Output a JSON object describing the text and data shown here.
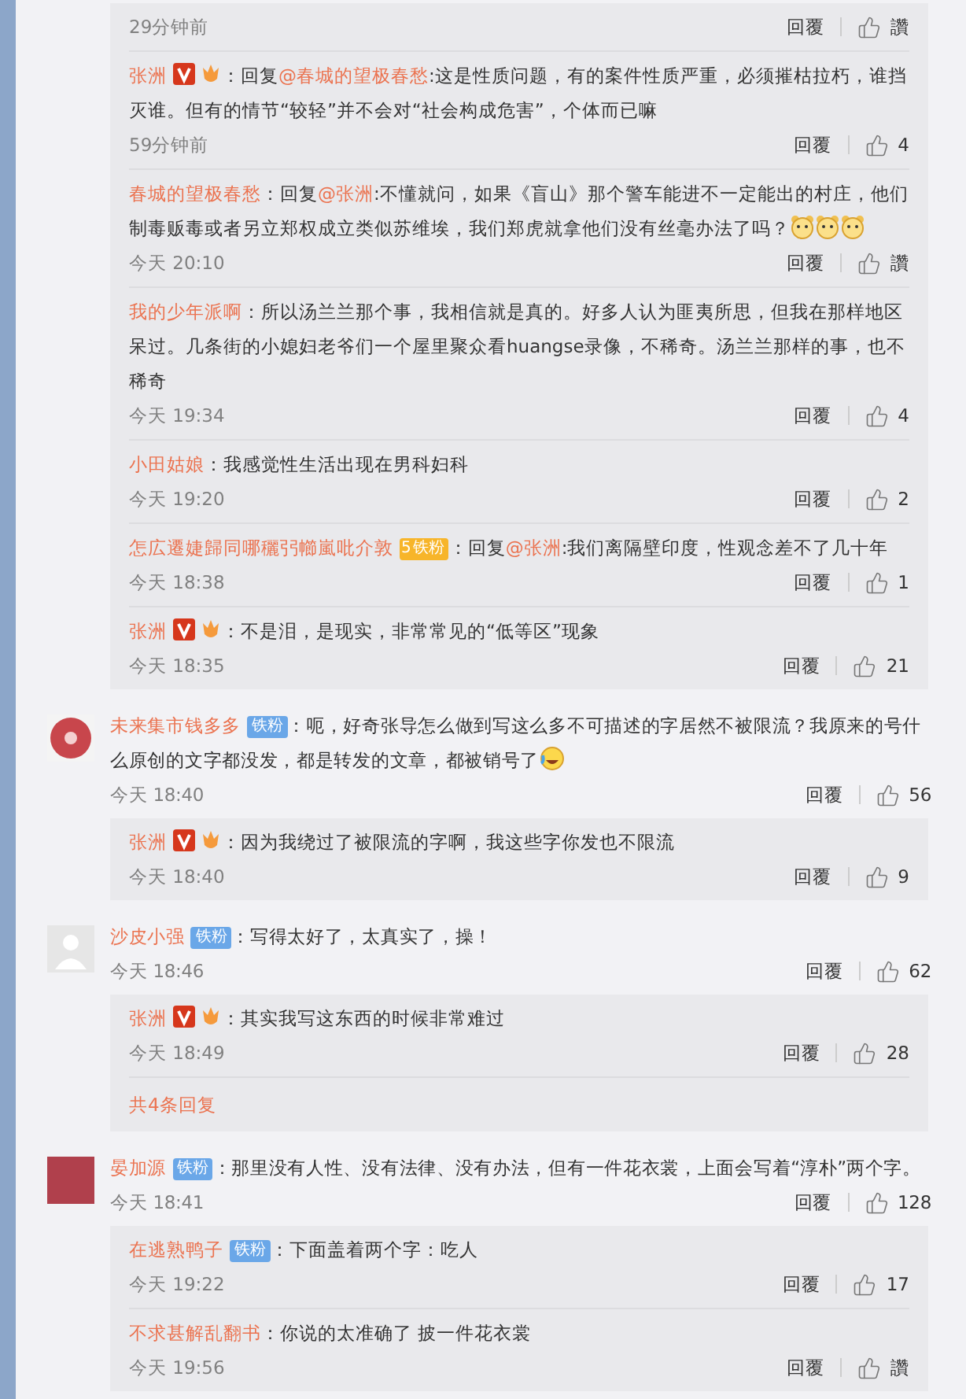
{
  "top_replies": [
    {
      "time": "29分钟前",
      "reply_label": "回覆",
      "likes": "讚"
    },
    {
      "user": "张洲",
      "badges": [
        {
          "kind": "verified"
        },
        {
          "kind": "medal"
        }
      ],
      "prefix": "：回复",
      "mention": "@春城的望极春愁",
      "text": ":这是性质问题，有的案件性质严重，必须摧枯拉朽，谁挡灭谁。但有的情节“较轻”并不会对“社会构成危害”，个体而已嘛",
      "time": "59分钟前",
      "reply_label": "回覆",
      "likes": "4"
    },
    {
      "user": "春城的望极春愁",
      "prefix": "：回复",
      "mention": "@张洲",
      "text": ":不懂就问，如果《盲山》那个警车能进不一定能出的村庄，他们制毒贩毒或者另立郑权成立类似苏维埃，我们郑虎就拿他们没有丝毫办法了吗？",
      "emojis": [
        {
          "kind": "bear"
        },
        {
          "kind": "bear"
        },
        {
          "kind": "bear"
        }
      ],
      "time": "今天 20:10",
      "reply_label": "回覆",
      "likes": "讚"
    },
    {
      "user": "我的少年派啊",
      "prefix": "：所以汤兰兰那个事，我相信就是真的。好多人认为匪夷所思，但我在那样地区呆过。几条街的小媳妇老爷们一个屋里聚众看huangse录像，不稀奇。汤兰兰那样的事，也不稀奇",
      "time": "今天 19:34",
      "reply_label": "回覆",
      "likes": "4"
    },
    {
      "user": "小田姑娘",
      "prefix": "：我感觉性生活出现在男科妇科",
      "time": "今天 19:20",
      "reply_label": "回覆",
      "likes": "2"
    },
    {
      "user": "怎広遷婕歸同哪穲弜幯嵐吡介敦",
      "badges": [
        {
          "kind": "gold_fan",
          "number": "5",
          "label": "铁粉"
        }
      ],
      "prefix": "：回复",
      "mention": "@张洲",
      "text": ":我们离隔壁印度，性观念差不了几十年",
      "time": "今天 18:38",
      "reply_label": "回覆",
      "likes": "1"
    },
    {
      "user": "张洲",
      "badges": [
        {
          "kind": "verified"
        },
        {
          "kind": "medal"
        }
      ],
      "prefix": "：不是泪，是现实，非常常见的“低等区”现象",
      "time": "今天 18:35",
      "reply_label": "回覆",
      "likes": "21"
    }
  ],
  "comments": [
    {
      "avatar": {
        "kind": "seal"
      },
      "user": "未来集市钱多多",
      "badges": [
        {
          "kind": "fan",
          "label": "铁粉"
        }
      ],
      "prefix": "：呃，好奇张导怎么做到写这么多不可描述的字居然不被限流？我原来的号什么原创的文字都没发，都是转发的文章，都被销号了",
      "emojis": [
        {
          "kind": "laugh-cry"
        }
      ],
      "time": "今天 18:40",
      "reply_label": "回覆",
      "likes": "56",
      "replies": [
        {
          "user": "张洲",
          "badges": [
            {
              "kind": "verified"
            },
            {
              "kind": "medal"
            }
          ],
          "prefix": "：因为我绕过了被限流的字啊，我这些字你发也不限流",
          "time": "今天 18:40",
          "reply_label": "回覆",
          "likes": "9"
        }
      ]
    },
    {
      "avatar": {
        "kind": "silhouette"
      },
      "user": "沙皮小强",
      "badges": [
        {
          "kind": "fan",
          "label": "铁粉"
        }
      ],
      "prefix": "：写得太好了，太真实了，操！",
      "time": "今天 18:46",
      "reply_label": "回覆",
      "likes": "62",
      "replies": [
        {
          "user": "张洲",
          "badges": [
            {
              "kind": "verified"
            },
            {
              "kind": "medal"
            }
          ],
          "prefix": "：其实我写这东西的时候非常难过",
          "time": "今天 18:49",
          "reply_label": "回覆",
          "likes": "28"
        }
      ],
      "more_replies": "共4条回复"
    },
    {
      "avatar": {
        "kind": "photo"
      },
      "user": "晏加源",
      "badges": [
        {
          "kind": "fan",
          "label": "铁粉"
        }
      ],
      "prefix": "：那里没有人性、没有法律、没有办法，但有一件花衣裳，上面会写着“淳朴”两个字。",
      "time": "今天 18:41",
      "reply_label": "回覆",
      "likes": "128",
      "replies": [
        {
          "user": "在逃熟鸭子",
          "badges": [
            {
              "kind": "fan",
              "label": "铁粉"
            }
          ],
          "prefix": "：下面盖着两个字：吃人",
          "time": "今天 19:22",
          "reply_label": "回覆",
          "likes": "17"
        },
        {
          "user": "不求甚解乱翻书",
          "prefix": "：你说的太准确了 披一件花衣裳",
          "time": "今天 19:56",
          "reply_label": "回覆",
          "likes": "讚"
        }
      ]
    }
  ]
}
